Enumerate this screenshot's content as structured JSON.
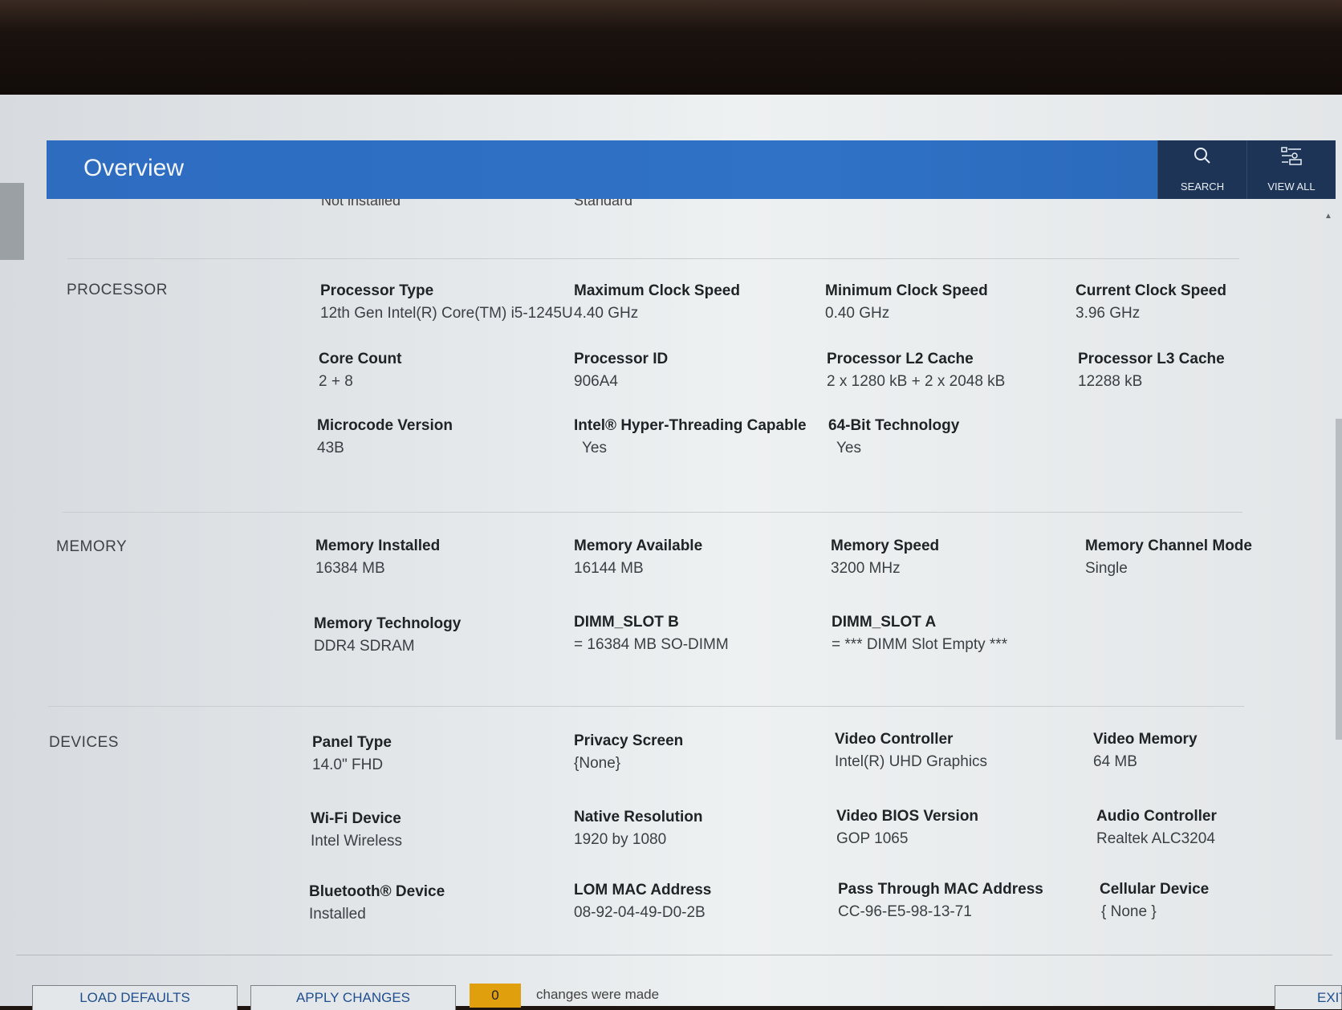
{
  "header": {
    "title": "Overview",
    "search_label": "SEARCH",
    "viewall_label": "VIEW ALL"
  },
  "clipped_top": {
    "left": "Not installed",
    "right": "Standard"
  },
  "sections": {
    "processor": {
      "label": "PROCESSOR",
      "fields": [
        {
          "name": "Processor Type",
          "value": "12th Gen Intel(R) Core(TM) i5-1245U"
        },
        {
          "name": "Maximum Clock Speed",
          "value": "4.40 GHz"
        },
        {
          "name": "Minimum Clock Speed",
          "value": "0.40 GHz"
        },
        {
          "name": "Current Clock Speed",
          "value": "3.96 GHz"
        },
        {
          "name": "Core Count",
          "value": "2 + 8"
        },
        {
          "name": "Processor ID",
          "value": "906A4"
        },
        {
          "name": "Processor L2 Cache",
          "value": "2 x 1280  kB + 2 x 2048  kB"
        },
        {
          "name": "Processor L3 Cache",
          "value": "12288 kB"
        },
        {
          "name": "Microcode Version",
          "value": "43B"
        },
        {
          "name": "Intel® Hyper-Threading Capable",
          "value": "Yes"
        },
        {
          "name": "64-Bit Technology",
          "value": "Yes"
        }
      ]
    },
    "memory": {
      "label": "MEMORY",
      "fields": [
        {
          "name": "Memory Installed",
          "value": "16384 MB"
        },
        {
          "name": "Memory Available",
          "value": "16144 MB"
        },
        {
          "name": "Memory Speed",
          "value": "3200 MHz"
        },
        {
          "name": "Memory Channel Mode",
          "value": "Single"
        },
        {
          "name": "Memory Technology",
          "value": "DDR4 SDRAM"
        },
        {
          "name": "DIMM_SLOT B",
          "value": "= 16384 MB SO-DIMM"
        },
        {
          "name": "DIMM_SLOT A",
          "value": "= *** DIMM Slot Empty ***"
        }
      ]
    },
    "devices": {
      "label": "DEVICES",
      "fields": [
        {
          "name": "Panel Type",
          "value": "14.0\" FHD"
        },
        {
          "name": "Privacy Screen",
          "value": "{None}"
        },
        {
          "name": "Video Controller",
          "value": "Intel(R) UHD Graphics"
        },
        {
          "name": "Video Memory",
          "value": "64 MB"
        },
        {
          "name": "Wi-Fi Device",
          "value": "Intel Wireless"
        },
        {
          "name": "Native Resolution",
          "value": "1920 by 1080"
        },
        {
          "name": "Video BIOS Version",
          "value": "GOP 1065"
        },
        {
          "name": "Audio Controller",
          "value": "Realtek ALC3204"
        },
        {
          "name": "Bluetooth® Device",
          "value": "Installed"
        },
        {
          "name": "LOM MAC Address",
          "value": "08-92-04-49-D0-2B"
        },
        {
          "name": "Pass Through MAC Address",
          "value": "CC-96-E5-98-13-71"
        },
        {
          "name": "Cellular Device",
          "value": "{ None }"
        }
      ]
    }
  },
  "footer": {
    "load_defaults": "LOAD DEFAULTS",
    "apply_changes": "APPLY CHANGES",
    "change_count": "0",
    "changes_text": "changes were made",
    "exit": "EXIT"
  }
}
